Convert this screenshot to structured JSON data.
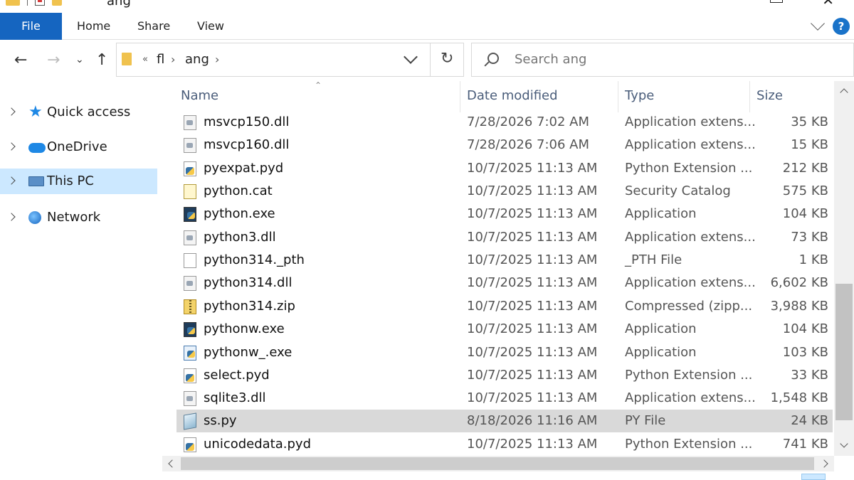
{
  "window": {
    "title": "ang"
  },
  "ribbon": {
    "file_label": "File",
    "tabs": [
      "Home",
      "Share",
      "View"
    ],
    "help_label": "?"
  },
  "address": {
    "overflow": "«",
    "crumbs": [
      "fl",
      "ang"
    ],
    "refresh_glyph": "↻"
  },
  "search": {
    "placeholder": "Search ang"
  },
  "navigation": {
    "items": [
      {
        "label": "Quick access",
        "icon": "star-icon"
      },
      {
        "label": "OneDrive",
        "icon": "cloud-icon"
      },
      {
        "label": "This PC",
        "icon": "computer-icon",
        "selected": true
      },
      {
        "label": "Network",
        "icon": "network-icon"
      }
    ]
  },
  "columns": {
    "name": "Name",
    "date": "Date modified",
    "type": "Type",
    "size": "Size"
  },
  "files": [
    {
      "name": "msvcp150.dll",
      "date": "7/28/2026 7:02 AM",
      "type": "Application extens...",
      "size": "35 KB",
      "icon": "dll-file-icon"
    },
    {
      "name": "msvcp160.dll",
      "date": "7/28/2026 7:06 AM",
      "type": "Application extens...",
      "size": "15 KB",
      "icon": "dll-file-icon"
    },
    {
      "name": "pyexpat.pyd",
      "date": "10/7/2025 11:13 AM",
      "type": "Python Extension ...",
      "size": "212 KB",
      "icon": "python-extension-icon"
    },
    {
      "name": "python.cat",
      "date": "10/7/2025 11:13 AM",
      "type": "Security Catalog",
      "size": "575 KB",
      "icon": "security-catalog-icon"
    },
    {
      "name": "python.exe",
      "date": "10/7/2025 11:13 AM",
      "type": "Application",
      "size": "104 KB",
      "icon": "python-exe-icon"
    },
    {
      "name": "python3.dll",
      "date": "10/7/2025 11:13 AM",
      "type": "Application extens...",
      "size": "73 KB",
      "icon": "dll-file-icon"
    },
    {
      "name": "python314._pth",
      "date": "10/7/2025 11:13 AM",
      "type": "_PTH File",
      "size": "1 KB",
      "icon": "blank-file-icon"
    },
    {
      "name": "python314.dll",
      "date": "10/7/2025 11:13 AM",
      "type": "Application extens...",
      "size": "6,602 KB",
      "icon": "dll-file-icon"
    },
    {
      "name": "python314.zip",
      "date": "10/7/2025 11:13 AM",
      "type": "Compressed (zipp...",
      "size": "3,988 KB",
      "icon": "zip-file-icon"
    },
    {
      "name": "pythonw.exe",
      "date": "10/7/2025 11:13 AM",
      "type": "Application",
      "size": "104 KB",
      "icon": "python-exe-icon"
    },
    {
      "name": "pythonw_.exe",
      "date": "10/7/2025 11:13 AM",
      "type": "Application",
      "size": "103 KB",
      "icon": "python-window-exe-icon"
    },
    {
      "name": "select.pyd",
      "date": "10/7/2025 11:13 AM",
      "type": "Python Extension ...",
      "size": "33 KB",
      "icon": "python-extension-icon"
    },
    {
      "name": "sqlite3.dll",
      "date": "10/7/2025 11:13 AM",
      "type": "Application extens...",
      "size": "1,548 KB",
      "icon": "dll-file-icon"
    },
    {
      "name": "ss.py",
      "date": "8/18/2026 11:16 AM",
      "type": "PY File",
      "size": "24 KB",
      "icon": "py-file-icon",
      "selected": true
    },
    {
      "name": "unicodedata.pyd",
      "date": "10/7/2025 11:13 AM",
      "type": "Python Extension ...",
      "size": "741 KB",
      "icon": "python-extension-icon"
    }
  ]
}
